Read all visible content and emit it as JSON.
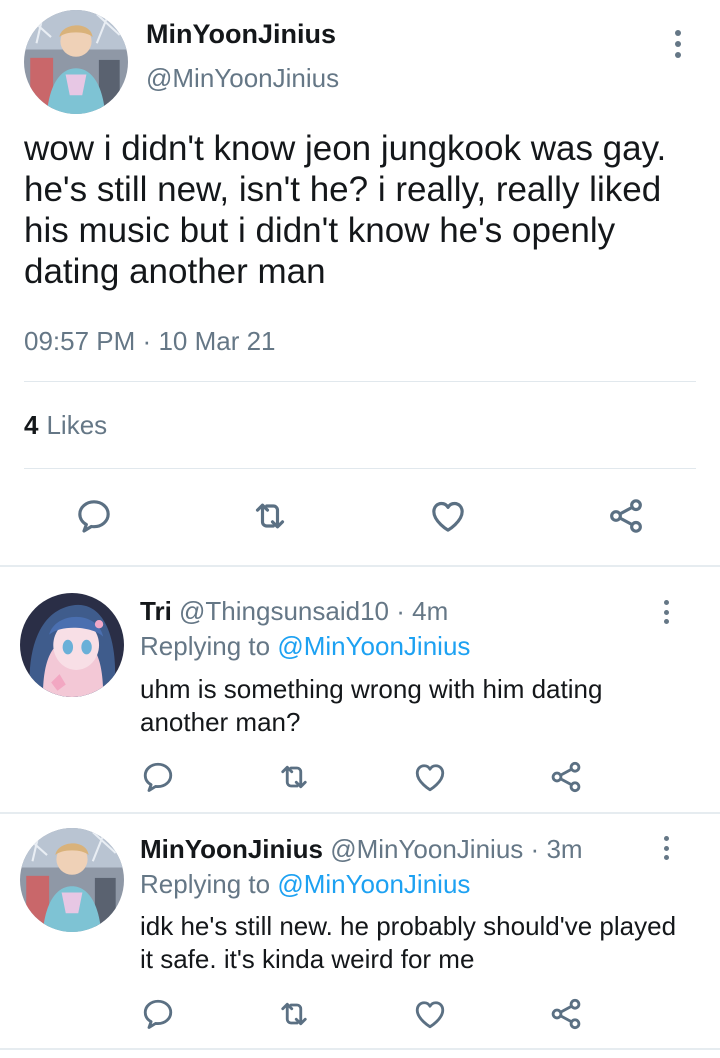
{
  "main_tweet": {
    "display_name": "MinYoonJinius",
    "handle": "@MinYoonJinius",
    "text": "wow i didn't know jeon jungkook was gay. he's still new, isn't he? i really, really liked his music but i didn't know he's openly dating another man",
    "time": "09:57 PM",
    "date": "10 Mar 21",
    "separator": "·",
    "likes_count": "4",
    "likes_label": "Likes",
    "avatar": "profile-photo",
    "actions": [
      "reply-icon",
      "retweet-icon",
      "like-icon",
      "share-icon"
    ]
  },
  "replies": [
    {
      "display_name": "Tri",
      "handle": "@Thingsunsaid10",
      "age": "4m",
      "separator": "·",
      "replying_prefix": "Replying to",
      "replying_to": "@MinYoonJinius",
      "text": "uhm is something wrong with him dating another man?",
      "avatar": "anime-girl-avatar"
    },
    {
      "display_name": "MinYoonJinius",
      "handle": "@MinYoonJinius",
      "age": "3m",
      "separator": "·",
      "replying_prefix": "Replying to",
      "replying_to": "@MinYoonJinius",
      "text": "idk he's still new. he probably should've played it safe. it's kinda weird for me",
      "avatar": "profile-photo"
    }
  ],
  "colors": {
    "primary_text": "#14171a",
    "secondary_text": "#657786",
    "mention": "#1da1f2",
    "divider": "#e1e8ed",
    "icon": "#5b7083"
  }
}
